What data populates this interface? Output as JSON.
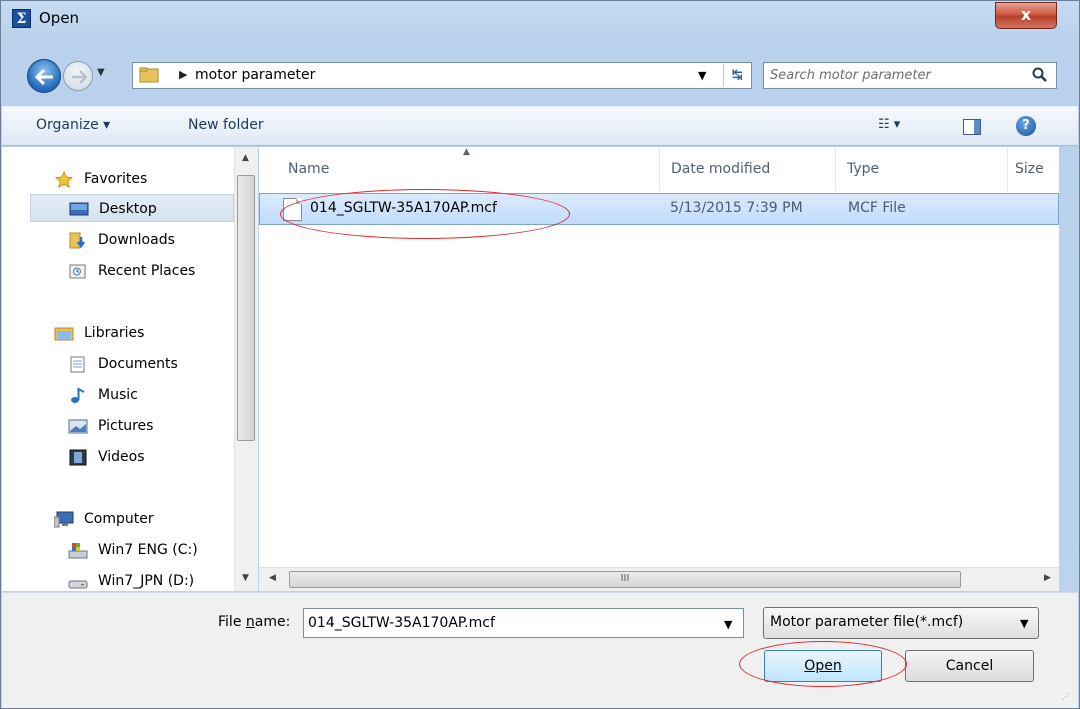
{
  "window": {
    "title": "Open",
    "app_icon_glyph": "Σ",
    "close_glyph": "x"
  },
  "address_bar": {
    "path": "motor parameter",
    "search_placeholder": "Search motor parameter"
  },
  "toolbar": {
    "organize_label": "Organize ▾",
    "new_folder_label": "New folder"
  },
  "nav_pane": {
    "items": [
      {
        "label": "Favorites",
        "icon": "star-icon"
      },
      {
        "label": "Desktop",
        "icon": "desktop-icon",
        "selected": true
      },
      {
        "label": "Downloads",
        "icon": "downloads-icon"
      },
      {
        "label": "Recent Places",
        "icon": "recent-places-icon"
      },
      {
        "label": "Libraries",
        "icon": "libraries-icon"
      },
      {
        "label": "Documents",
        "icon": "documents-icon"
      },
      {
        "label": "Music",
        "icon": "music-icon"
      },
      {
        "label": "Pictures",
        "icon": "pictures-icon"
      },
      {
        "label": "Videos",
        "icon": "videos-icon"
      },
      {
        "label": "Computer",
        "icon": "computer-icon"
      },
      {
        "label": "Win7 ENG (C:)",
        "icon": "drive-c-icon"
      },
      {
        "label": "Win7_JPN (D:)",
        "icon": "drive-d-icon"
      }
    ]
  },
  "file_list": {
    "columns": [
      "Name",
      "Date modified",
      "Type",
      "Size"
    ],
    "rows": [
      {
        "name": "014_SGLTW-35A170AP.mcf",
        "date_modified": "5/13/2015 7:39 PM",
        "type": "MCF File",
        "selected": true
      }
    ],
    "scroll_thumb_glyph": "III"
  },
  "bottom": {
    "file_name_label_pre": "File ",
    "file_name_label_ul": "n",
    "file_name_label_post": "ame:",
    "file_name_value": "014_SGLTW-35A170AP.mcf",
    "file_type_selected": "Motor parameter file(*.mcf)",
    "open_label": "Open",
    "cancel_label": "Cancel"
  },
  "colors": {
    "annotation_red": "#e0262a",
    "selection_blue": "#c1dbfc"
  }
}
